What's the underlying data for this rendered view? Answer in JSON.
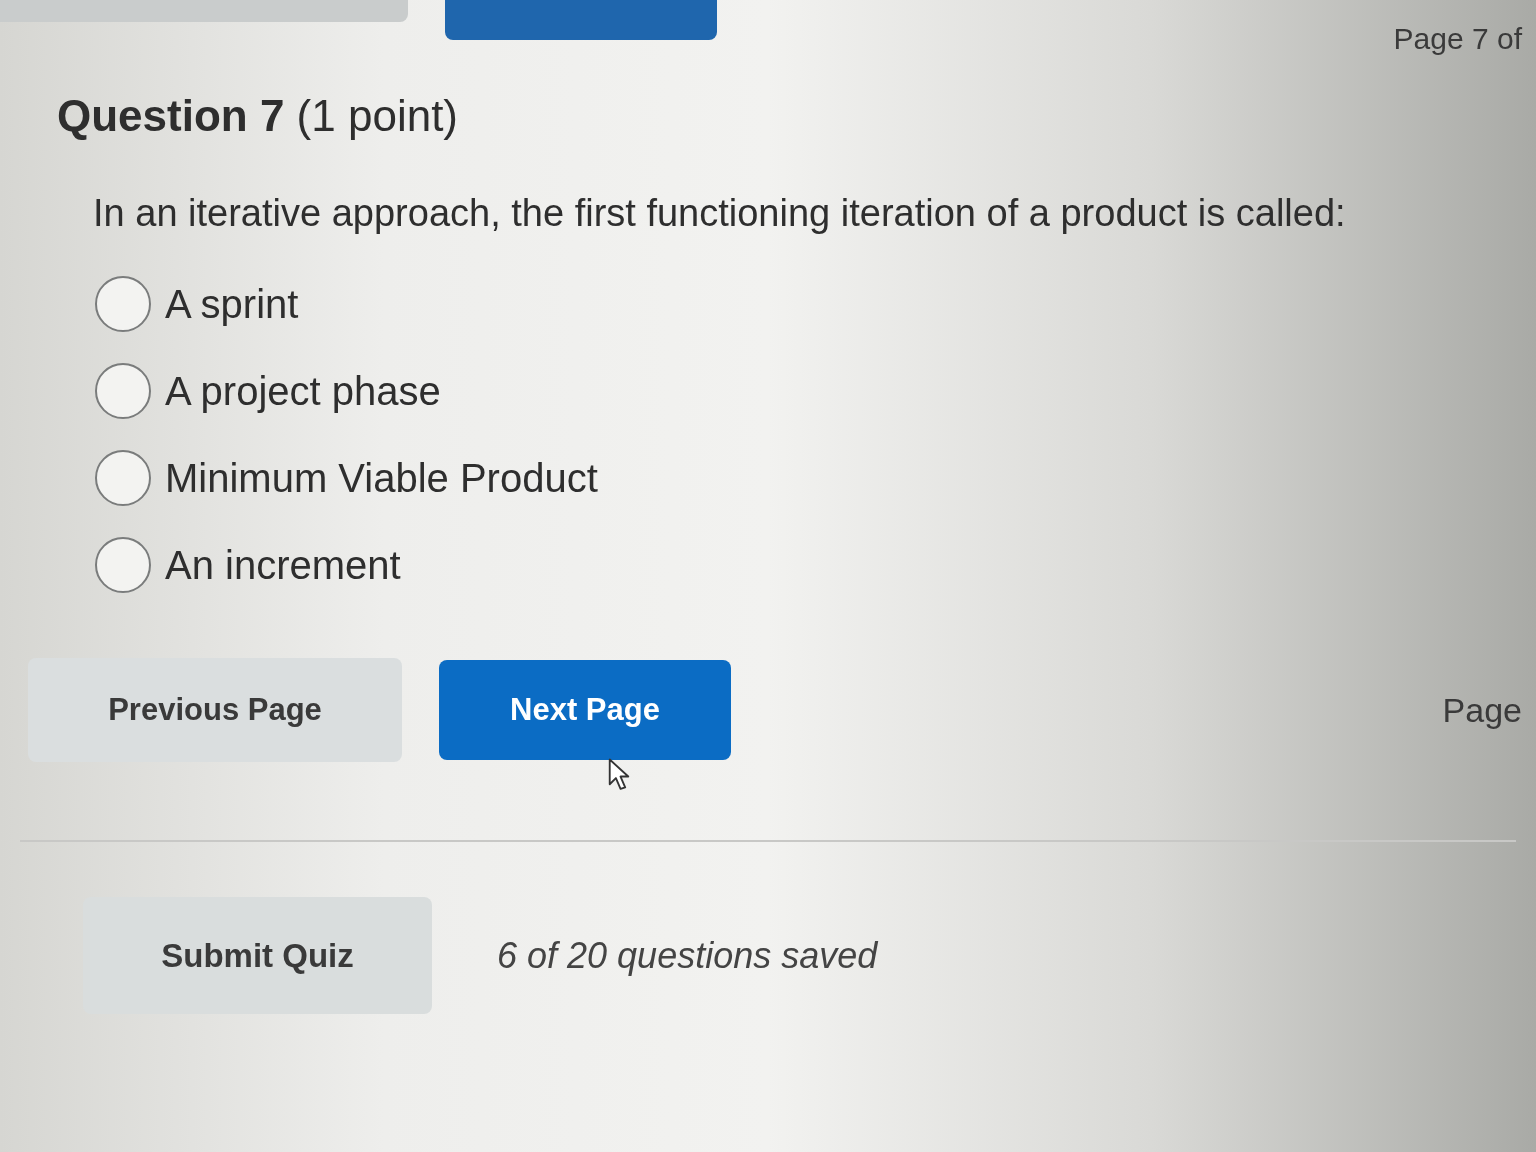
{
  "top_buttons": [
    {
      "kind": "secondary"
    },
    {
      "kind": "primary"
    }
  ],
  "page_label_top": "Page 7 of",
  "question": {
    "title": "Question 7",
    "points": "(1 point)",
    "text": "In an iterative approach, the first functioning iteration of a product is called:",
    "options": [
      {
        "label": "A sprint",
        "selected": false
      },
      {
        "label": "A project phase",
        "selected": false
      },
      {
        "label": "Minimum Viable Product",
        "selected": false
      },
      {
        "label": "An increment",
        "selected": false
      }
    ]
  },
  "nav_buttons": [
    {
      "label": "Previous Page",
      "kind": "secondary"
    },
    {
      "label": "Next Page",
      "kind": "primary"
    }
  ],
  "page_label_bottom": "Page",
  "submit_button": "Submit Quiz",
  "save_status": "6 of 20 questions saved"
}
